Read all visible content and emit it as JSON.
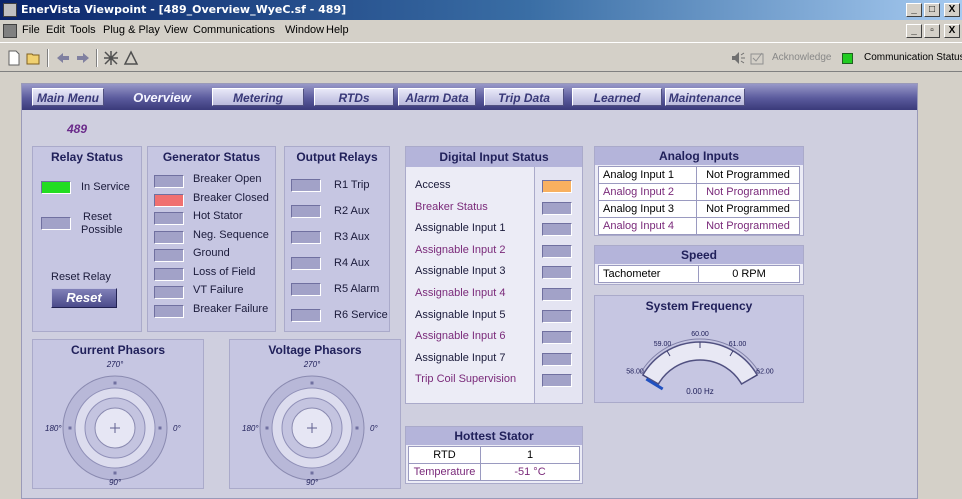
{
  "window": {
    "title": "EnerVista Viewpoint - [489_Overview_WyeC.sf - 489]",
    "controls": [
      "_",
      "□",
      "X"
    ],
    "mdi_controls": [
      "_",
      "▫",
      "X"
    ]
  },
  "menu": {
    "items": [
      "File",
      "Edit",
      "Tools",
      "Plug & Play",
      "View",
      "Communications",
      "Window",
      "Help"
    ]
  },
  "toolbar": {
    "icons": [
      "new-icon",
      "open-icon",
      "back-icon",
      "forward-icon",
      "device-icon",
      "alert-icon"
    ],
    "acknowledge_label": "Acknowledge",
    "comm_status_label": "Communication Status",
    "comm_status_color": "#22cc22"
  },
  "nav": {
    "tabs": [
      "Main Menu",
      "Overview",
      "Metering",
      "RTDs",
      "Alarm Data",
      "Trip Data",
      "Learned",
      "Maintenance"
    ],
    "active": "Overview"
  },
  "relay_id": "489",
  "relay_status": {
    "title": "Relay Status",
    "in_service_label": "In Service",
    "in_service_color": "#22dd22",
    "reset_possible_line1": "Reset",
    "reset_possible_line2": "Possible",
    "reset_relay_label": "Reset Relay",
    "reset_button": "Reset"
  },
  "generator_status": {
    "title": "Generator Status",
    "items": [
      {
        "label": "Breaker Open",
        "state": "off"
      },
      {
        "label": "Breaker Closed",
        "state": "red"
      },
      {
        "label": "Hot Stator",
        "state": "off"
      },
      {
        "label": "Neg. Sequence",
        "state": "off"
      },
      {
        "label": "Ground",
        "state": "off"
      },
      {
        "label": "Loss of Field",
        "state": "off"
      },
      {
        "label": "VT Failure",
        "state": "off"
      },
      {
        "label": "Breaker Failure",
        "state": "off"
      }
    ]
  },
  "output_relays": {
    "title": "Output Relays",
    "items": [
      "R1 Trip",
      "R2 Aux",
      "R3 Aux",
      "R4 Aux",
      "R5 Alarm",
      "R6 Service"
    ]
  },
  "digital_inputs": {
    "title": "Digital Input Status",
    "items": [
      {
        "label": "Access",
        "style": "normal",
        "state": "orange"
      },
      {
        "label": "Breaker Status",
        "style": "mag",
        "state": "off"
      },
      {
        "label": "Assignable Input 1",
        "style": "normal",
        "state": "off"
      },
      {
        "label": "Assignable Input 2",
        "style": "mag",
        "state": "off"
      },
      {
        "label": "Assignable Input 3",
        "style": "normal",
        "state": "off"
      },
      {
        "label": "Assignable Input 4",
        "style": "mag",
        "state": "off"
      },
      {
        "label": "Assignable Input 5",
        "style": "normal",
        "state": "off"
      },
      {
        "label": "Assignable Input 6",
        "style": "mag",
        "state": "off"
      },
      {
        "label": "Assignable Input 7",
        "style": "normal",
        "state": "off"
      },
      {
        "label": "Trip Coil Supervision",
        "style": "mag",
        "state": "off"
      }
    ]
  },
  "analog_inputs": {
    "title": "Analog Inputs",
    "rows": [
      {
        "name": "Analog Input 1",
        "value": "Not Programmed",
        "style": "normal"
      },
      {
        "name": "Analog Input 2",
        "value": "Not Programmed",
        "style": "mag"
      },
      {
        "name": "Analog Input 3",
        "value": "Not Programmed",
        "style": "normal"
      },
      {
        "name": "Analog Input 4",
        "value": "Not Programmed",
        "style": "mag"
      }
    ]
  },
  "speed": {
    "title": "Speed",
    "label": "Tachometer",
    "value": "0 RPM"
  },
  "system_frequency": {
    "title": "System Frequency",
    "ticks": [
      "58.00",
      "59.00",
      "60.00",
      "61.00",
      "62.00"
    ],
    "readout": "0.00 Hz",
    "value_hz": 0.0,
    "range_hz": [
      58.0,
      62.0
    ]
  },
  "current_phasors": {
    "title": "Current Phasors",
    "angles": [
      "270°",
      "180°",
      "0°",
      "90°"
    ]
  },
  "voltage_phasors": {
    "title": "Voltage Phasors",
    "angles": [
      "270°",
      "180°",
      "0°",
      "90°"
    ]
  },
  "hottest_stator": {
    "title": "Hottest Stator",
    "rtd_label": "RTD",
    "rtd_value": "1",
    "temp_label": "Temperature",
    "temp_value": "-51 °C"
  }
}
